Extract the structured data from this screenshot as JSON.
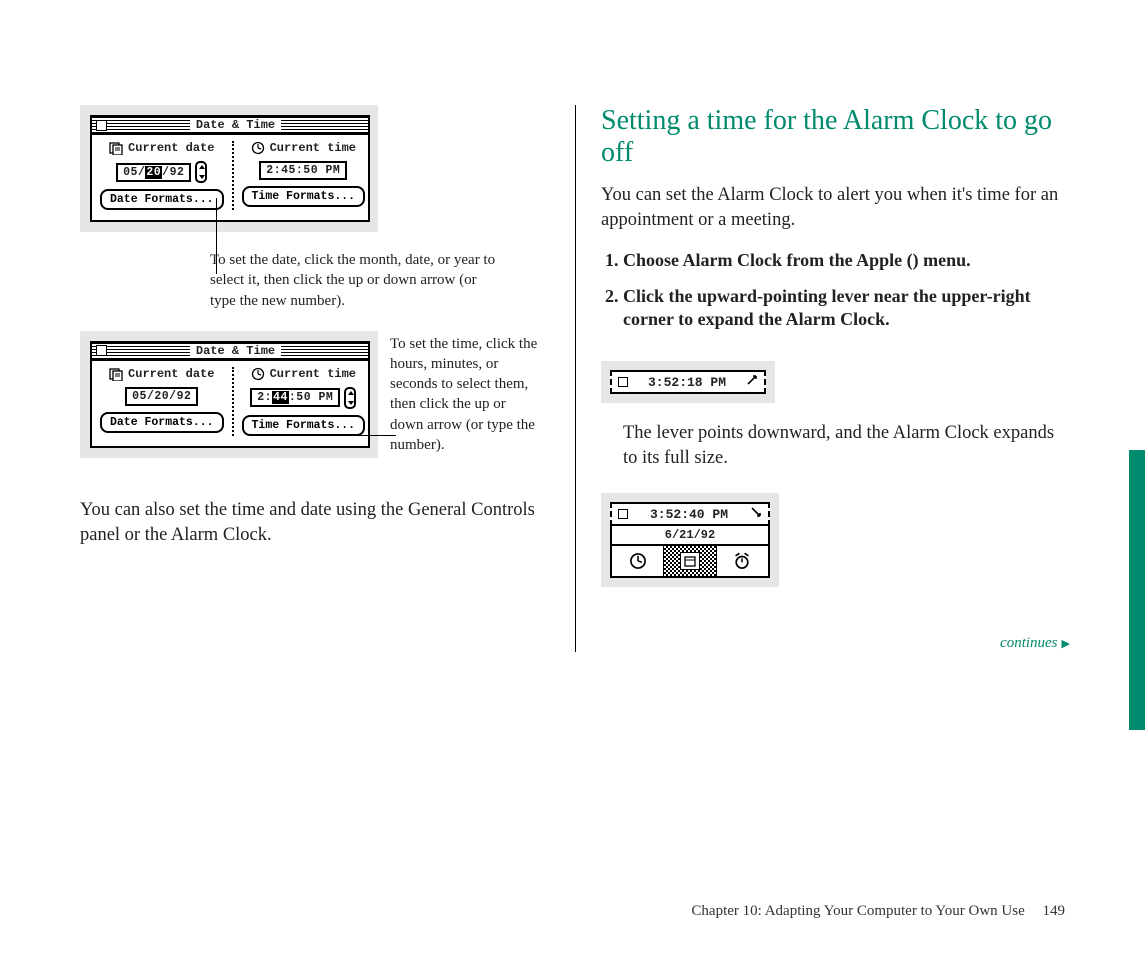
{
  "left": {
    "win": {
      "title": "Date & Time",
      "date_label": "Current date",
      "time_label": "Current time",
      "date_formats": "Date Formats...",
      "time_formats": "Time Formats..."
    },
    "fig1": {
      "date_pre": "05/",
      "date_sel": "20",
      "date_post": "/92",
      "time": "2:45:50 PM"
    },
    "callout_date": "To set the date, click the month, date, or year to select it, then click the up or down arrow (or type the new number).",
    "fig2": {
      "date": "05/20/92",
      "time_pre": "2:",
      "time_sel": "44",
      "time_post": ":50 PM"
    },
    "callout_time": "To set the time, click the hours, minutes, or seconds to select them, then click the up or down arrow (or type the number).",
    "body": "You can also set the time and date using the General Controls panel or the Alarm Clock."
  },
  "right": {
    "heading": "Setting a time for the Alarm Clock to go off",
    "intro": "You can set the Alarm Clock to alert you when it's time for an appointment or a meeting.",
    "step1_a": "Choose Alarm Clock from the Apple (",
    "step1_b": ") menu.",
    "step2": "Click the upward-pointing lever near the upper-right corner to expand the Alarm Clock.",
    "ac_collapsed_time": "3:52:18 PM",
    "after1": "The lever points downward, and the Alarm Clock expands to its full size.",
    "ac_expanded_time": "3:52:40 PM",
    "ac_expanded_date": "6/21/92",
    "continues": "continues"
  },
  "footer": {
    "chapter": "Chapter 10:  Adapting Your Computer to Your Own Use",
    "page": "149"
  }
}
